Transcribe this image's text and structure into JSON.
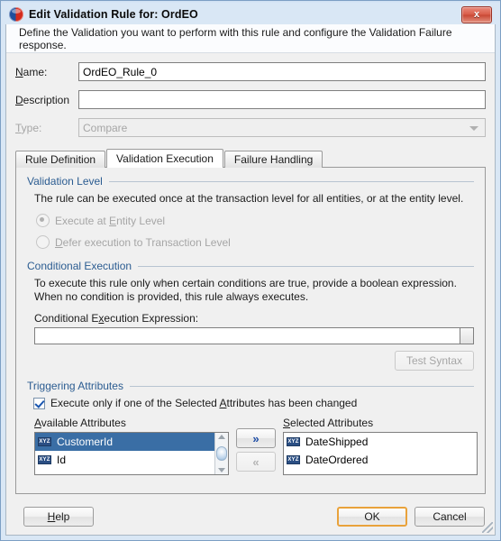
{
  "window": {
    "title": "Edit Validation Rule for: OrdEO",
    "icon": "oracle-jdeveloper-icon",
    "close_label": "x"
  },
  "header": {
    "description": "Define the Validation you want to perform with this rule and configure the Validation Failure response."
  },
  "form": {
    "name_label": "Name:",
    "name_value": "OrdEO_Rule_0",
    "description_label": "Description",
    "description_value": "",
    "type_label": "Type:",
    "type_value": "Compare"
  },
  "tabs": [
    {
      "label": "Rule Definition",
      "active": false
    },
    {
      "label": "Validation Execution",
      "active": true
    },
    {
      "label": "Failure Handling",
      "active": false
    }
  ],
  "validation_level": {
    "group_title": "Validation Level",
    "description": "The rule can be executed once at the transaction level for all entities, or at the entity level.",
    "options": [
      {
        "label": "Execute at Entity Level",
        "checked": true,
        "disabled": true
      },
      {
        "label": "Defer execution to Transaction Level",
        "checked": false,
        "disabled": true
      }
    ]
  },
  "conditional_execution": {
    "group_title": "Conditional Execution",
    "description": "To execute this rule only when certain conditions are true, provide a boolean expression. When no condition is provided, this rule always executes.",
    "expression_label": "Conditional Execution Expression:",
    "expression_value": "",
    "test_syntax_label": "Test Syntax",
    "test_syntax_disabled": true
  },
  "triggering_attributes": {
    "group_title": "Triggering Attributes",
    "checkbox_label": "Execute only if one of the Selected Attributes has been changed",
    "checkbox_checked": true,
    "available_caption": "Available Attributes",
    "selected_caption": "Selected Attributes",
    "available_items": [
      {
        "label": "CustomerId",
        "icon": "xyz-attribute-icon",
        "selected": true
      },
      {
        "label": "Id",
        "icon": "xyz-attribute-icon",
        "selected": false
      }
    ],
    "selected_items": [
      {
        "label": "DateShipped",
        "icon": "xyz-attribute-icon"
      },
      {
        "label": "DateOrdered",
        "icon": "xyz-attribute-icon"
      }
    ],
    "add_button_label": "»",
    "remove_button_label": "«",
    "icon_text": "XYZ"
  },
  "footer": {
    "help_label": "Help",
    "ok_label": "OK",
    "cancel_label": "Cancel"
  },
  "colors": {
    "title_bar": "#d9e7f5",
    "group_title": "#2b5c91",
    "selection": "#3a6ea5",
    "focus_border": "#e9a23b",
    "close_button": "#c84733"
  }
}
